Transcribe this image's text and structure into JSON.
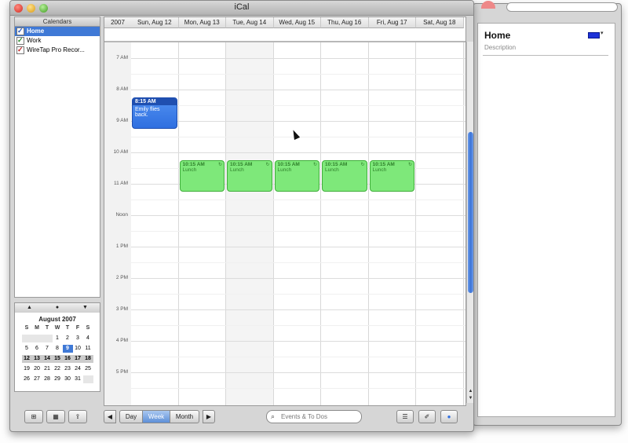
{
  "window": {
    "title": "iCal"
  },
  "sidebar": {
    "header": "Calendars",
    "items": [
      {
        "label": "Home",
        "color": "blue",
        "selected": true
      },
      {
        "label": "Work",
        "color": "green",
        "selected": false
      },
      {
        "label": "WireTap Pro Recor...",
        "color": "red",
        "selected": false
      }
    ]
  },
  "minical": {
    "nav": {
      "prev": "▲",
      "today": "●",
      "next": "▼"
    },
    "title": "August 2007",
    "dow": [
      "S",
      "M",
      "T",
      "W",
      "T",
      "F",
      "S"
    ],
    "weeks": [
      [
        "",
        "",
        "",
        "1",
        "2",
        "3",
        "4"
      ],
      [
        "5",
        "6",
        "7",
        "8",
        "9",
        "10",
        "11"
      ],
      [
        "12",
        "13",
        "14",
        "15",
        "16",
        "17",
        "18"
      ],
      [
        "19",
        "20",
        "21",
        "22",
        "23",
        "24",
        "25"
      ],
      [
        "26",
        "27",
        "28",
        "29",
        "30",
        "31",
        ""
      ]
    ],
    "today": "9",
    "highlight_week": 2
  },
  "week_view": {
    "year": "2007",
    "days": [
      "Sun, Aug 12",
      "Mon, Aug 13",
      "Tue, Aug 14",
      "Wed, Aug 15",
      "Thu, Aug 16",
      "Fri, Aug 17",
      "Sat, Aug 18"
    ],
    "today_index": 2,
    "hours": [
      {
        "h": "7",
        "ampm": "AM"
      },
      {
        "h": "8",
        "ampm": "AM"
      },
      {
        "h": "9",
        "ampm": "AM"
      },
      {
        "h": "10",
        "ampm": "AM"
      },
      {
        "h": "11",
        "ampm": "AM"
      },
      {
        "h": "Noon",
        "ampm": ""
      },
      {
        "h": "1",
        "ampm": "PM"
      },
      {
        "h": "2",
        "ampm": "PM"
      },
      {
        "h": "3",
        "ampm": "PM"
      },
      {
        "h": "4",
        "ampm": "PM"
      },
      {
        "h": "5",
        "ampm": "PM"
      }
    ],
    "events": [
      {
        "day": 0,
        "start": 8.25,
        "end": 9.25,
        "time": "8:15 AM",
        "title": "Emily flies back.",
        "calendar": "Home"
      },
      {
        "day": 1,
        "start": 10.25,
        "end": 11.25,
        "time": "10:15 AM",
        "title": "Lunch",
        "calendar": "Work"
      },
      {
        "day": 2,
        "start": 10.25,
        "end": 11.25,
        "time": "10:15 AM",
        "title": "Lunch",
        "calendar": "Work"
      },
      {
        "day": 3,
        "start": 10.25,
        "end": 11.25,
        "time": "10:15 AM",
        "title": "Lunch",
        "calendar": "Work"
      },
      {
        "day": 4,
        "start": 10.25,
        "end": 11.25,
        "time": "10:15 AM",
        "title": "Lunch",
        "calendar": "Work"
      },
      {
        "day": 5,
        "start": 10.25,
        "end": 11.25,
        "time": "10:15 AM",
        "title": "Lunch",
        "calendar": "Work"
      }
    ]
  },
  "toolbar": {
    "day": "Day",
    "week": "Week",
    "month": "Month",
    "prev": "◀",
    "next": "▶",
    "search_placeholder": "Events & To Dos"
  },
  "drawer": {
    "title": "Home",
    "description": "Description",
    "color": "#1d32d8"
  },
  "colors": {
    "home": "#2f6fe0",
    "work": "#7ee87a",
    "selection": "#3f79d6"
  }
}
